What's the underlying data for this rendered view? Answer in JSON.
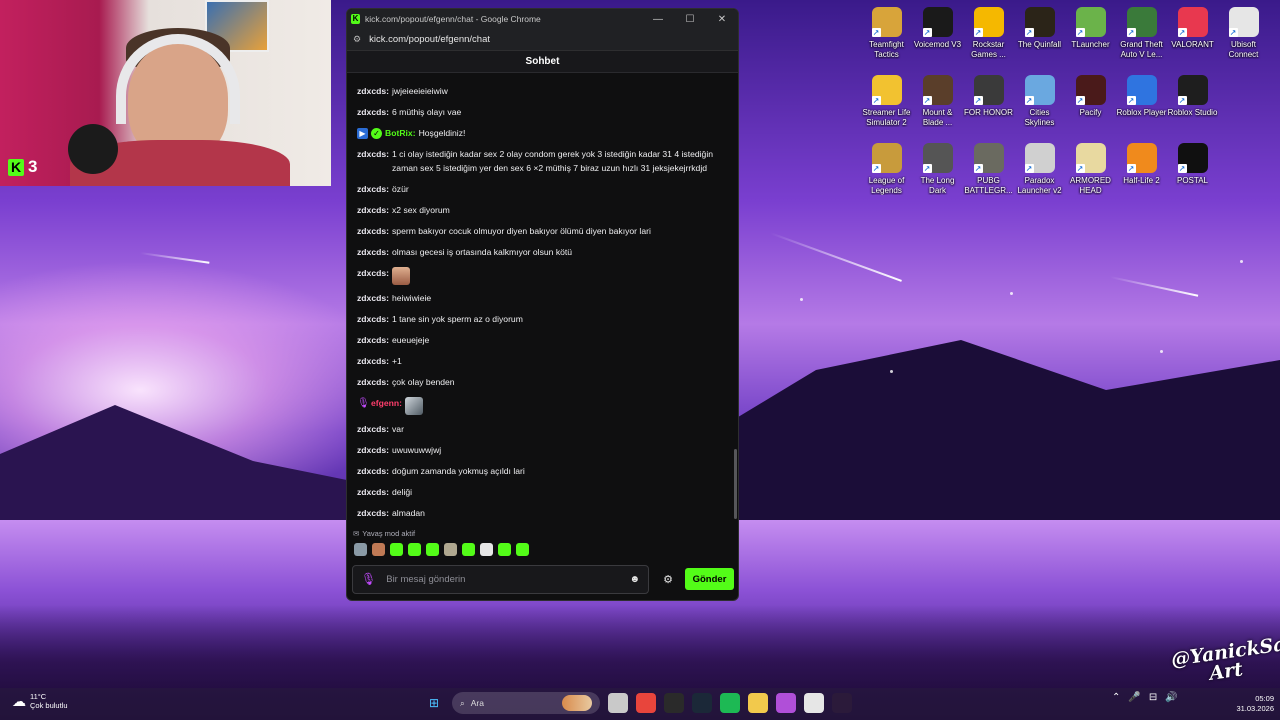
{
  "webcam": {
    "viewer_count": "3"
  },
  "desktop": {
    "rows": [
      [
        {
          "label": "Teamfight Tactics",
          "icon": "tft-icon",
          "color": "#d8a43a"
        },
        {
          "label": "Voicemod V3",
          "icon": "voicemod-icon",
          "color": "#1a1a1a"
        },
        {
          "label": "Rockstar Games ...",
          "icon": "rockstar-icon",
          "color": "#f5b800"
        },
        {
          "label": "The Quinfall",
          "icon": "quinfall-icon",
          "color": "#2b2418"
        },
        {
          "label": "TLauncher",
          "icon": "tlauncher-icon",
          "color": "#6bb34a"
        },
        {
          "label": "Grand Theft Auto V Le...",
          "icon": "gta-v-icon",
          "color": "#3a7a3a"
        },
        {
          "label": "VALORANT",
          "icon": "valorant-icon",
          "color": "#e8384f"
        },
        {
          "label": "Ubisoft Connect",
          "icon": "ubisoft-icon",
          "color": "#e6e6e6"
        }
      ],
      [
        {
          "label": "Streamer Life Simulator 2",
          "icon": "streamer-life-icon",
          "color": "#f2c230"
        },
        {
          "label": "Mount & Blade ...",
          "icon": "mount-blade-icon",
          "color": "#5a3e2a"
        },
        {
          "label": "FOR HONOR",
          "icon": "for-honor-icon",
          "color": "#3a3a3a"
        },
        {
          "label": "Cities Skylines",
          "icon": "cities-skylines-icon",
          "color": "#6aa8e0"
        },
        {
          "label": "Pacify",
          "icon": "pacify-icon",
          "color": "#4a1a1a"
        },
        {
          "label": "Roblox Player",
          "icon": "roblox-icon",
          "color": "#2f74e0"
        },
        {
          "label": "Roblox Studio",
          "icon": "roblox-studio-icon",
          "color": "#1e1e1e"
        }
      ],
      [
        {
          "label": "League of Legends",
          "icon": "league-icon",
          "color": "#c89b3c"
        },
        {
          "label": "The Long Dark",
          "icon": "long-dark-icon",
          "color": "#555555"
        },
        {
          "label": "PUBG BATTLEGR...",
          "icon": "pubg-icon",
          "color": "#6a6a60"
        },
        {
          "label": "Paradox Launcher v2",
          "icon": "paradox-icon",
          "color": "#d0d0d0"
        },
        {
          "label": "ARMORED HEAD",
          "icon": "armored-head-icon",
          "color": "#e8d9a0"
        },
        {
          "label": "Half-Life 2",
          "icon": "half-life-icon",
          "color": "#f08a1c"
        },
        {
          "label": "POSTAL",
          "icon": "postal-icon",
          "color": "#101010"
        }
      ]
    ]
  },
  "browser": {
    "window_title": "kick.com/popout/efgenn/chat - Google Chrome",
    "url": "kick.com/popout/efgenn/chat",
    "chat_header": "Sohbet"
  },
  "chat": {
    "messages": [
      {
        "user": "zdxcds",
        "text": "jwjeieeieieiwiw"
      },
      {
        "user": "zdxcds",
        "text": "6 müthiş olayı vae"
      },
      {
        "user": "BotRix",
        "text": "Hoşgeldiniz!",
        "type": "bot"
      },
      {
        "user": "zdxcds",
        "text": "1 ci olay istediğin kadar sex 2 olay condom gerek yok 3 istediğin kadar 31 4 istediğin zaman sex 5 istediğim yer den sex 6 ×2 müthiş 7 biraz uzun hızlı 31 jeksjekejrrkdjd"
      },
      {
        "user": "zdxcds",
        "text": "özür"
      },
      {
        "user": "zdxcds",
        "text": "x2 sex diyorum"
      },
      {
        "user": "zdxcds",
        "text": "sperm bakıyor cocuk olmuyor diyen bakıyor ölümü diyen bakıyor lari"
      },
      {
        "user": "zdxcds",
        "text": "olması gecesi iş ortasında kalkmıyor olsun kötü"
      },
      {
        "user": "zdxcds",
        "text": "",
        "emote": "face"
      },
      {
        "user": "zdxcds",
        "text": "heiwiwieie"
      },
      {
        "user": "zdxcds",
        "text": "1 tane sin yok sperm az o diyorum"
      },
      {
        "user": "zdxcds",
        "text": "eueuejeje"
      },
      {
        "user": "zdxcds",
        "text": "+1"
      },
      {
        "user": "zdxcds",
        "text": "çok olay benden"
      },
      {
        "user": "efgenn",
        "text": "",
        "type": "streamer",
        "emote": "eagle"
      },
      {
        "user": "zdxcds",
        "text": "var"
      },
      {
        "user": "zdxcds",
        "text": "uwuwuwwjwj"
      },
      {
        "user": "zdxcds",
        "text": "doğum zamanda yokmuş açıldı lari"
      },
      {
        "user": "zdxcds",
        "text": "deliği"
      },
      {
        "user": "zdxcds",
        "text": "almadan"
      }
    ],
    "slow_mode": "Yavaş mod aktif",
    "emote_colors": [
      "#8a9aa6",
      "#c07a55",
      "#53fc18",
      "#53fc18",
      "#53fc18",
      "#b0a890",
      "#53fc18",
      "#e6e6e6",
      "#53fc18",
      "#53fc18"
    ],
    "input_placeholder": "Bir mesaj gönderin",
    "send_label": "Gönder"
  },
  "watermark": {
    "line1": "@YanickSan",
    "line2": "Art"
  },
  "taskbar": {
    "weather_temp": "11°C",
    "weather_desc": "Çok bulutlu",
    "search_placeholder": "Ara",
    "apps": [
      {
        "icon": "file-explorer-widget-icon",
        "color": "#c9c9c9"
      },
      {
        "icon": "chrome-icon",
        "color": "#e8453c"
      },
      {
        "icon": "obs-icon",
        "color": "#2a2a2a"
      },
      {
        "icon": "steam-icon",
        "color": "#1b2838"
      },
      {
        "icon": "spotify-icon",
        "color": "#1db954"
      },
      {
        "icon": "folder-icon",
        "color": "#f2c94c"
      },
      {
        "icon": "game-icon",
        "color": "#b04fd8"
      },
      {
        "icon": "store-icon",
        "color": "#e6e6e6"
      },
      {
        "icon": "kick-app-icon",
        "color": "#2b1a3a"
      }
    ],
    "time": "05:09",
    "date": "31.03.2026"
  }
}
